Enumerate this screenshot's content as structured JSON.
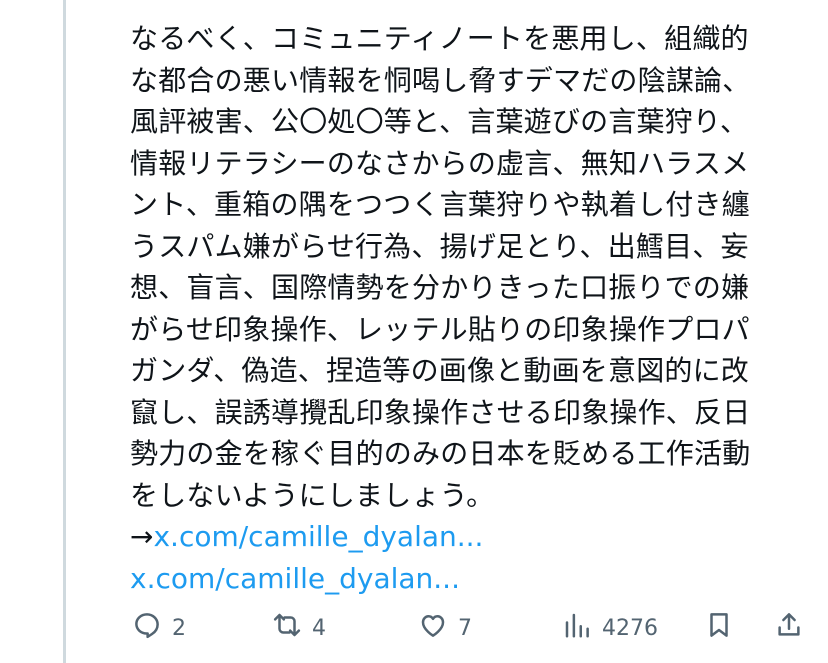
{
  "tweet": {
    "text": "なるべく、コミュニティノートを悪用し、組織的\nな都合の悪い情報を恫喝し脅すデマだの陰謀論、\n風評被害、公〇処〇等と、言葉遊びの言葉狩り、\n情報リテラシーのなさからの虚言、無知ハラスメ\nント、重箱の隅をつつく言葉狩りや執着し付き纏\nうスパム嫌がらせ行為、揚げ足とり、出鱈目、妄\n想、盲言、国際情勢を分かりきった口振りでの嫌\nがらせ印象操作、レッテル貼りの印象操作プロパ\nガンダ、偽造、捏造等の画像と動画を意図的に改\n竄し、誤誘導攪乱印象操作させる印象操作、反日\n勢力の金を稼ぐ目的のみの日本を貶める工作活動\nをしないようにしましょう。",
    "arrow": "→",
    "links": [
      "x.com/camille_dyalan...",
      "x.com/camille_dyalan..."
    ]
  },
  "actions": {
    "replies": "2",
    "reposts": "4",
    "likes": "7",
    "views": "4276"
  },
  "icons": [
    "reply-icon",
    "repost-icon",
    "like-icon",
    "views-icon",
    "bookmark-icon",
    "share-icon"
  ],
  "colors": {
    "link": "#1d9bf0",
    "muted": "#536471",
    "text": "#0f1419",
    "thread_line": "#cfd9de"
  }
}
